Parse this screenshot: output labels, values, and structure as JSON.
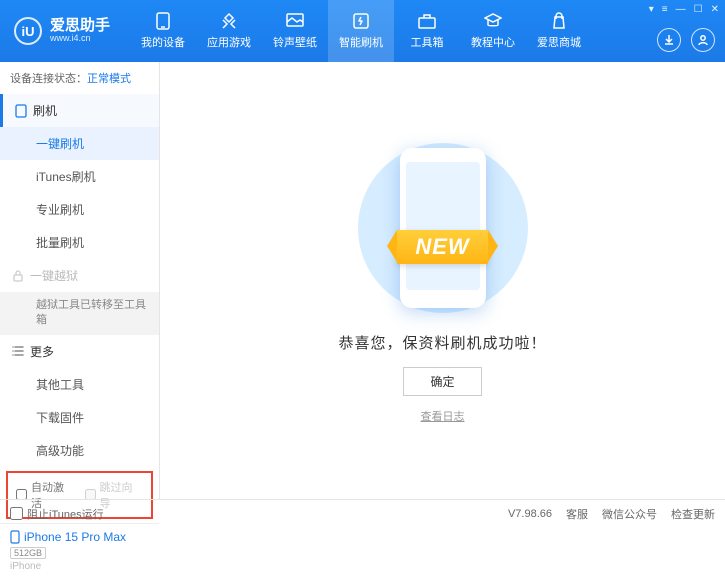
{
  "logo": {
    "icon": "iU",
    "title": "爱思助手",
    "sub": "www.i4.cn"
  },
  "nav": [
    {
      "label": "我的设备"
    },
    {
      "label": "应用游戏"
    },
    {
      "label": "铃声壁纸"
    },
    {
      "label": "智能刷机"
    },
    {
      "label": "工具箱"
    },
    {
      "label": "教程中心"
    },
    {
      "label": "爱思商城"
    }
  ],
  "status": {
    "label": "设备连接状态：",
    "value": "正常模式"
  },
  "sidebar": {
    "flash": {
      "title": "刷机",
      "items": [
        "一键刷机",
        "iTunes刷机",
        "专业刷机",
        "批量刷机"
      ]
    },
    "jailbreak": {
      "title": "一键越狱",
      "note": "越狱工具已转移至工具箱"
    },
    "more": {
      "title": "更多",
      "items": [
        "其他工具",
        "下载固件",
        "高级功能"
      ]
    }
  },
  "options": {
    "auto_activate": "自动激活",
    "skip_guide": "跳过向导"
  },
  "device": {
    "name": "iPhone 15 Pro Max",
    "storage": "512GB",
    "type": "iPhone"
  },
  "main": {
    "ribbon": "NEW",
    "success": "恭喜您，保资料刷机成功啦！",
    "ok": "确定",
    "view_log": "查看日志"
  },
  "footer": {
    "block_itunes": "阻止iTunes运行",
    "version": "V7.98.66",
    "links": [
      "客服",
      "微信公众号",
      "检查更新"
    ]
  }
}
